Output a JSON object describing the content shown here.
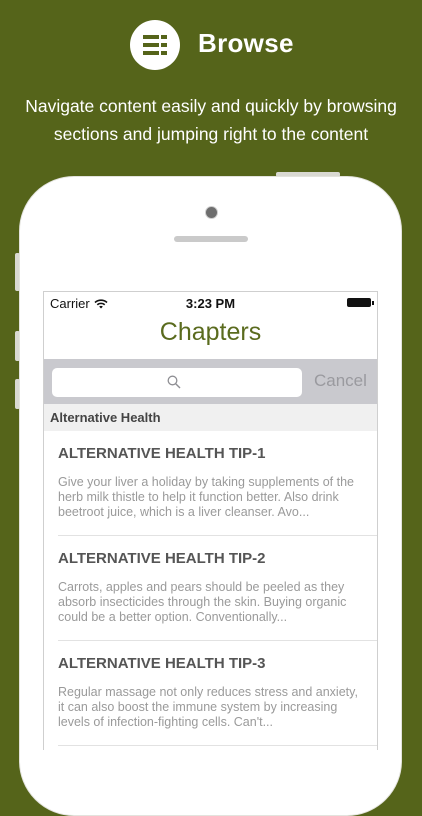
{
  "header": {
    "icon": "list-menu-icon",
    "title": "Browse",
    "subtitle_line1": "Navigate content easily and quickly by browsing",
    "subtitle_line2": "sections and jumping right to the content"
  },
  "statusbar": {
    "carrier": "Carrier",
    "time": "3:23 PM"
  },
  "nav": {
    "title": "Chapters"
  },
  "search": {
    "placeholder": "",
    "cancel_label": "Cancel"
  },
  "section": {
    "title": "Alternative Health"
  },
  "tips": [
    {
      "title": "ALTERNATIVE HEALTH TIP-1",
      "body": "Give your liver a holiday by taking supplements of the herb milk thistle to help it function better. Also drink beetroot juice, which is a liver cleanser. Avo..."
    },
    {
      "title": "ALTERNATIVE HEALTH TIP-2",
      "body": "Carrots, apples and pears should be peeled as they absorb insecticides through the skin. Buying organic could be a better option. Conventionally..."
    },
    {
      "title": "ALTERNATIVE HEALTH TIP-3",
      "body": "Regular massage not only reduces stress and anxiety, it can also boost the immune system by increasing levels of infection-fighting cells. Can't..."
    }
  ],
  "colors": {
    "background": "#55641a",
    "accent": "#5a6b1e"
  }
}
